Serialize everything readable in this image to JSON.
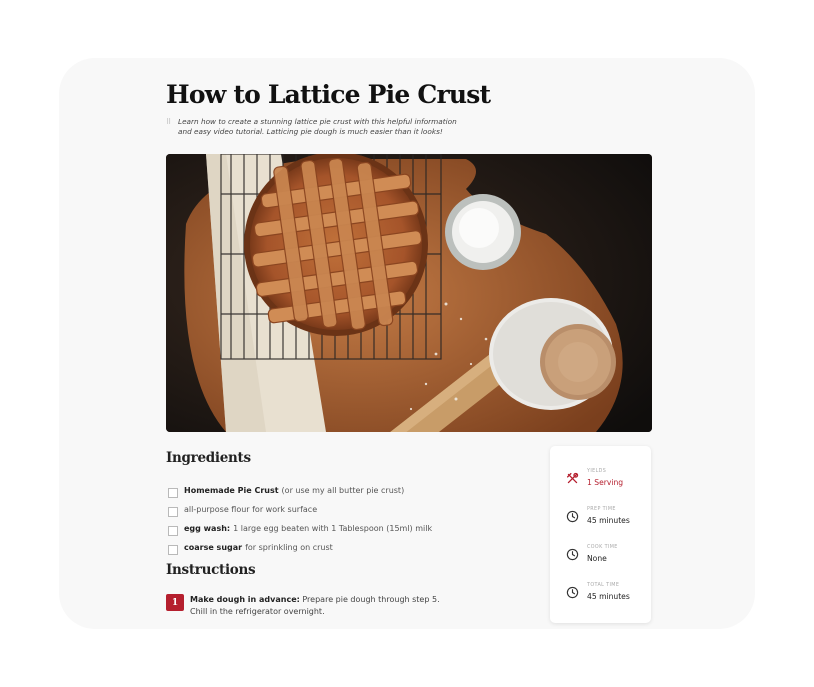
{
  "recipe": {
    "title": "How to Lattice Pie Crust",
    "description": "Learn how to create a stunning lattice pie crust with this helpful information and easy video tutorial. Latticing pie dough is much easier than it looks!",
    "image_alt": "lattice pie crust"
  },
  "ingredients": {
    "heading": "Ingredients",
    "items": [
      {
        "name": "Homemade Pie Crust",
        "note": "(or use my all butter pie crust)"
      },
      {
        "name": "",
        "note": "all-purpose flour for work surface"
      },
      {
        "name": "egg wash:",
        "note": "1 large egg beaten with 1 Tablespoon (15ml) milk"
      },
      {
        "name": "coarse sugar",
        "note": "for sprinkling on crust"
      }
    ]
  },
  "instructions": {
    "heading": "Instructions",
    "steps": [
      {
        "number": "1",
        "title": "Make dough in advance:",
        "text": "Prepare pie dough through step 5. Chill in the refrigerator overnight."
      }
    ]
  },
  "meta": {
    "yields_label": "YIELDS",
    "yields_value": "1 Serving",
    "prep_label": "PREP TIME",
    "prep_value": "45 minutes",
    "cook_label": "COOK TIME",
    "cook_value": "None",
    "total_label": "TOTAL TIME",
    "total_value": "45 minutes",
    "icons": [
      "utensils-icon",
      "clock-icon",
      "clock-icon",
      "clock-icon"
    ]
  },
  "colors": {
    "accent": "#b51f2e",
    "card_bg": "#f8f8f8"
  }
}
